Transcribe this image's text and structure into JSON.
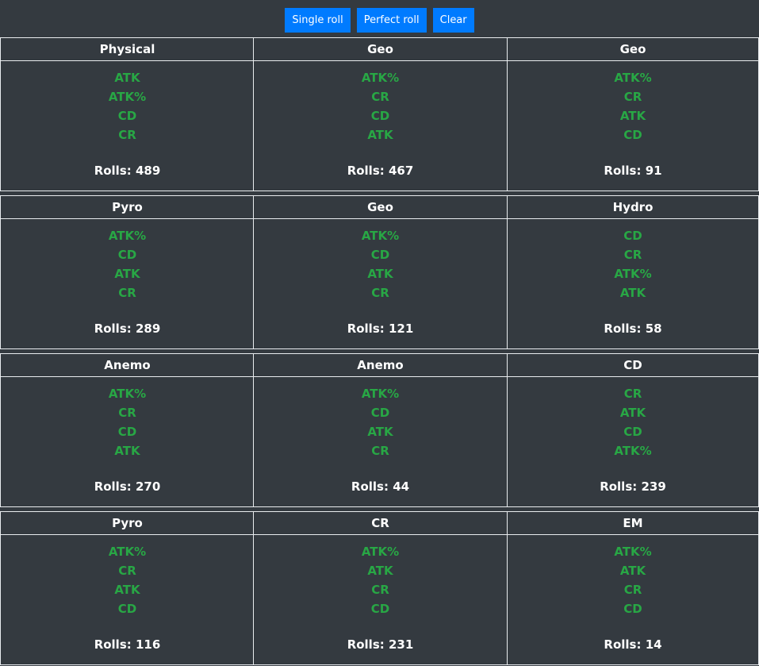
{
  "toolbar": {
    "single_roll_label": "Single roll",
    "perfect_roll_label": "Perfect roll",
    "clear_label": "Clear"
  },
  "rolls_prefix": "Rolls: ",
  "cards": [
    {
      "main": "Physical",
      "subs": [
        "ATK",
        "ATK%",
        "CD",
        "CR"
      ],
      "rolls": 489
    },
    {
      "main": "Geo",
      "subs": [
        "ATK%",
        "CR",
        "CD",
        "ATK"
      ],
      "rolls": 467
    },
    {
      "main": "Geo",
      "subs": [
        "ATK%",
        "CR",
        "ATK",
        "CD"
      ],
      "rolls": 91
    },
    {
      "main": "Pyro",
      "subs": [
        "ATK%",
        "CD",
        "ATK",
        "CR"
      ],
      "rolls": 289
    },
    {
      "main": "Geo",
      "subs": [
        "ATK%",
        "CD",
        "ATK",
        "CR"
      ],
      "rolls": 121
    },
    {
      "main": "Hydro",
      "subs": [
        "CD",
        "CR",
        "ATK%",
        "ATK"
      ],
      "rolls": 58
    },
    {
      "main": "Anemo",
      "subs": [
        "ATK%",
        "CR",
        "CD",
        "ATK"
      ],
      "rolls": 270
    },
    {
      "main": "Anemo",
      "subs": [
        "ATK%",
        "CD",
        "ATK",
        "CR"
      ],
      "rolls": 44
    },
    {
      "main": "CD",
      "subs": [
        "CR",
        "ATK",
        "CD",
        "ATK%"
      ],
      "rolls": 239
    },
    {
      "main": "Pyro",
      "subs": [
        "ATK%",
        "CR",
        "ATK",
        "CD"
      ],
      "rolls": 116
    },
    {
      "main": "CR",
      "subs": [
        "ATK%",
        "ATK",
        "CR",
        "CD"
      ],
      "rolls": 231
    },
    {
      "main": "EM",
      "subs": [
        "ATK%",
        "ATK",
        "CR",
        "CD"
      ],
      "rolls": 14
    }
  ],
  "colors": {
    "background": "#343a40",
    "button": "#007bff",
    "substat": "#28a745",
    "text": "#ffffff",
    "border": "#e9ecef"
  }
}
